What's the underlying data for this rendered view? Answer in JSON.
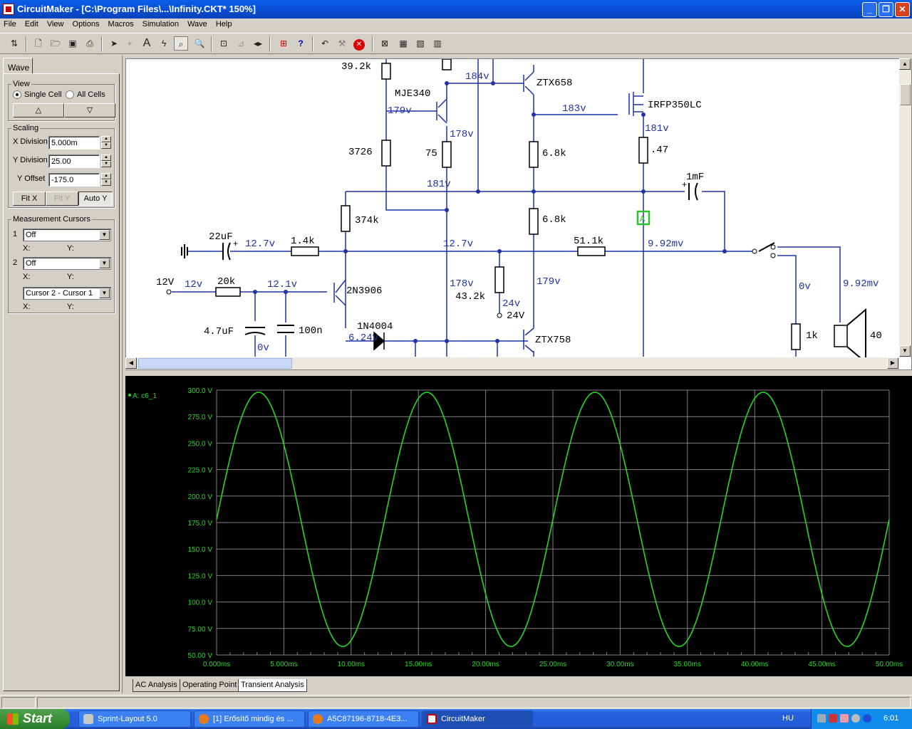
{
  "window": {
    "title": "CircuitMaker - [C:\\Program Files\\...\\Infinity.CKT* 150%]"
  },
  "menu": [
    "File",
    "Edit",
    "View",
    "Options",
    "Macros",
    "Simulation",
    "Wave",
    "Help"
  ],
  "toolbar_icons": [
    "wire-mode-icon",
    "new-icon",
    "open-icon",
    "save-icon",
    "print-icon",
    "arrow-icon",
    "wire-icon",
    "text-icon",
    "probe-icon",
    "wand-icon",
    "zoom-icon",
    "rubber-stamp-icon",
    "rotate-icon",
    "mirror-icon",
    "digital-icon",
    "help-icon",
    "reset-icon",
    "stop-icon",
    "trace-icon",
    "grid-icon",
    "graph-icon",
    "cursor-icon"
  ],
  "panel": {
    "tab": "Wave",
    "view": {
      "label": "View",
      "single": "Single Cell",
      "all": "All Cells",
      "selected": "Single Cell"
    },
    "scaling": {
      "label": "Scaling",
      "xdiv_label": "X Division",
      "xdiv": "5.000m",
      "ydiv_label": "Y Division",
      "ydiv": "25.00",
      "yoff_label": "Y Offset",
      "yoff": "-175.0",
      "fitx": "Fit X",
      "fity": "Fit Y",
      "autoy": "Auto Y"
    },
    "cursors": {
      "label": "Measurement Cursors",
      "c1_num": "1",
      "c1": "Off",
      "c2_num": "2",
      "c2": "Off",
      "diff": "Cursor 2 - Cursor 1",
      "x": "X:",
      "y": "Y:"
    }
  },
  "schematic": {
    "labels": [
      "39.2k",
      "MJE340",
      "184v",
      "ZTX658",
      "IRFP350LC",
      "179v",
      "183v",
      "178v",
      "181v",
      "3726",
      "75",
      "6.8k",
      ".47",
      "181v",
      "1mF",
      "374k",
      "6.8k",
      "A",
      "22uF",
      "12.7v",
      "1.4k",
      "12.7v",
      "51.1k",
      "9.92mv",
      "12V",
      "12v",
      "20k",
      "12.1v",
      "2N3906",
      "178v",
      "179v",
      "0v",
      "9.92mv",
      "43.2k",
      "24v",
      "24V",
      "4.7uF",
      "100n",
      "1k",
      "40",
      "1N4004",
      "6.24v",
      "ZTX758",
      "0v",
      "+",
      "+"
    ]
  },
  "scope": {
    "trace_label": "A: c6_1",
    "trace_color": "#22d922",
    "grid_color": "#808080",
    "label_color": "#22d922"
  },
  "chart_data": {
    "type": "line",
    "title": "",
    "xlabel": "",
    "ylabel": "",
    "xlim": [
      0,
      50
    ],
    "ylim": [
      50,
      300
    ],
    "x_unit": "ms",
    "y_unit": "V",
    "grid": true,
    "x_ticks": [
      "0.000ms",
      "5.000ms",
      "10.00ms",
      "15.00ms",
      "20.00ms",
      "25.00ms",
      "30.00ms",
      "35.00ms",
      "40.00ms",
      "45.00ms",
      "50.00ms"
    ],
    "y_ticks": [
      "300.0 V",
      "275.0 V",
      "250.0 V",
      "225.0 V",
      "200.0 V",
      "175.0 V",
      "150.0 V",
      "125.0 V",
      "100.0 V",
      "75.00 V",
      "50.00 V"
    ],
    "series": [
      {
        "name": "A: c6_1",
        "offset": 178,
        "amplitude": 120,
        "freq_hz": 80,
        "phase_deg": 0,
        "points": [
          [
            0,
            180
          ],
          [
            3.3,
            297
          ],
          [
            9.8,
            58
          ],
          [
            16,
            299
          ],
          [
            22.1,
            60
          ],
          [
            28.4,
            300
          ],
          [
            34.7,
            60
          ],
          [
            40.9,
            300
          ],
          [
            47.2,
            60
          ],
          [
            50,
            165
          ]
        ]
      }
    ]
  },
  "bottom_tabs": [
    "AC Analysis",
    "Operating Point",
    "Transient Analysis"
  ],
  "taskbar": {
    "start": "Start",
    "tasks": [
      "Sprint-Layout 5.0",
      "[1] Erősítő mindig és ...",
      "A5C87196-8718-4E3...",
      "CircuitMaker"
    ],
    "lang": "HU",
    "clock": "6:01"
  }
}
